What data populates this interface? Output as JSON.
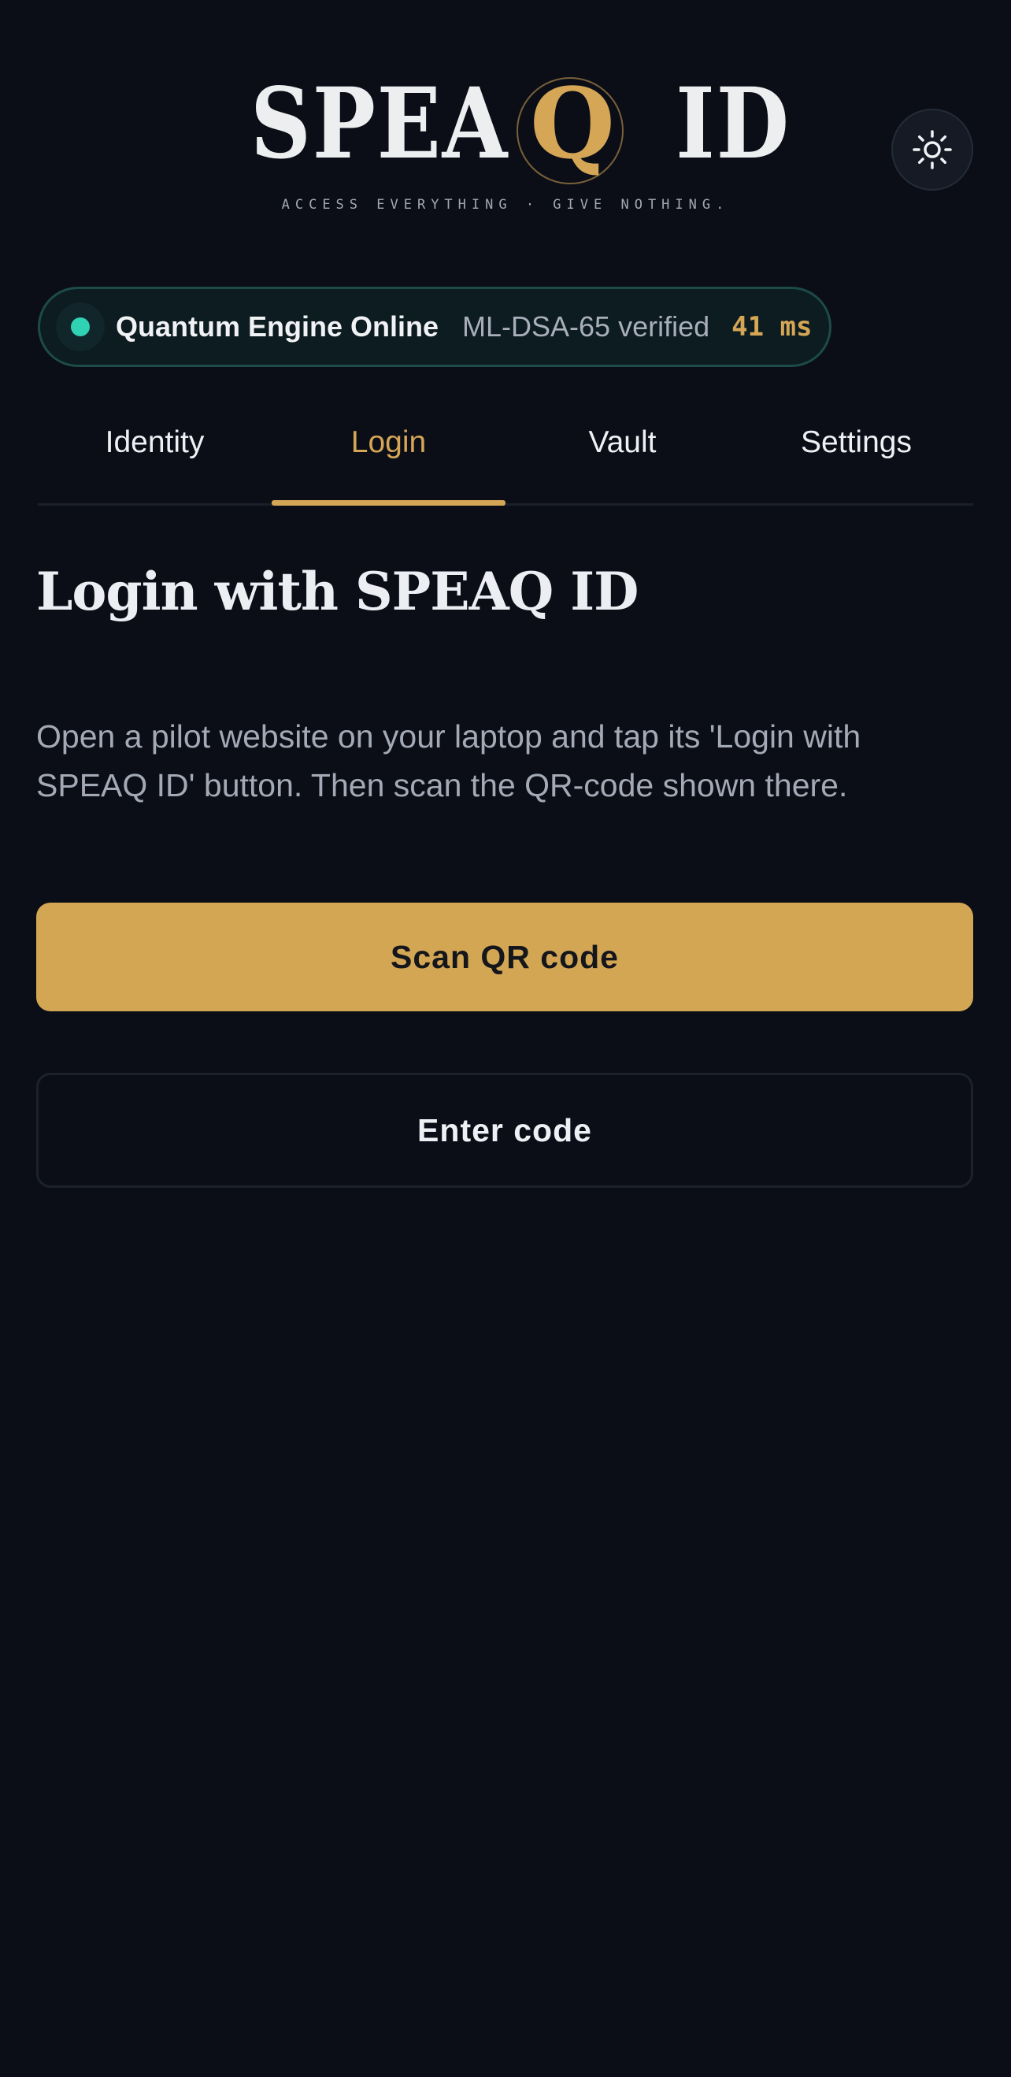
{
  "header": {
    "logo_left": "SPEA",
    "logo_q": "Q",
    "logo_right": "ID",
    "tagline": "ACCESS EVERYTHING · GIVE NOTHING.",
    "theme_toggle_icon": "sun-icon"
  },
  "status": {
    "label": "Quantum Engine Online",
    "verified": "ML-DSA-65 verified",
    "latency": "41 ms",
    "dot_color": "#2fd2b3"
  },
  "tabs": [
    {
      "label": "Identity",
      "active": false
    },
    {
      "label": "Login",
      "active": true
    },
    {
      "label": "Vault",
      "active": false
    },
    {
      "label": "Settings",
      "active": false
    }
  ],
  "main": {
    "title": "Login with SPEAQ ID",
    "description": "Open a pilot website on your laptop and tap its 'Login with SPEAQ ID' button. Then scan the QR-code shown there.",
    "scan_button": "Scan QR code",
    "enter_code_button": "Enter code"
  },
  "colors": {
    "background": "#0b0e17",
    "accent": "#d4a656",
    "status_green": "#2fd2b3"
  }
}
